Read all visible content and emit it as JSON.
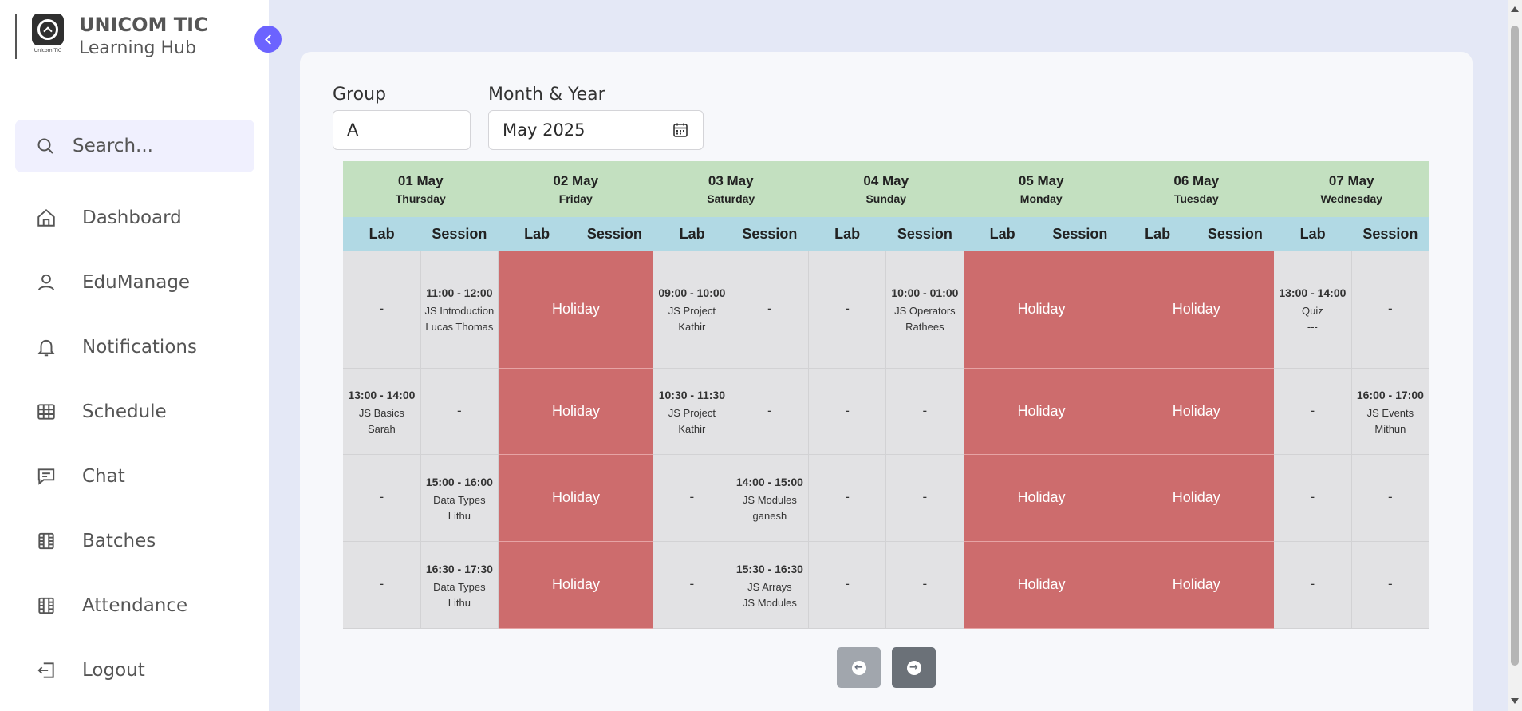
{
  "brand": {
    "title": "UNICOM TIC",
    "subtitle": "Learning Hub",
    "logo_caption": "Unicom TIC"
  },
  "search": {
    "placeholder": "Search..."
  },
  "nav": [
    {
      "label": "Dashboard",
      "icon": "home-icon"
    },
    {
      "label": "EduManage",
      "icon": "user-icon"
    },
    {
      "label": "Notifications",
      "icon": "bell-icon"
    },
    {
      "label": "Schedule",
      "icon": "table-icon"
    },
    {
      "label": "Chat",
      "icon": "chat-icon"
    },
    {
      "label": "Batches",
      "icon": "film-icon"
    },
    {
      "label": "Attendance",
      "icon": "film-icon"
    },
    {
      "label": "Logout",
      "icon": "logout-icon"
    }
  ],
  "filters": {
    "group_label": "Group",
    "group_value": "A",
    "month_label": "Month & Year",
    "month_value": "May 2025"
  },
  "schedule": {
    "sub_headers": {
      "lab": "Lab",
      "session": "Session"
    },
    "holiday_label": "Holiday",
    "empty": "-",
    "days": [
      {
        "date": "01 May",
        "weekday": "Thursday",
        "holiday": false,
        "rows": [
          {
            "lab": null,
            "session": {
              "time": "11:00 - 12:00",
              "topic": "JS Introduction",
              "teacher": "Lucas Thomas"
            }
          },
          {
            "lab": {
              "time": "13:00 - 14:00",
              "topic": "JS Basics",
              "teacher": "Sarah"
            },
            "session": null
          },
          {
            "lab": null,
            "session": {
              "time": "15:00 - 16:00",
              "topic": "Data Types",
              "teacher": "Lithu"
            }
          },
          {
            "lab": null,
            "session": {
              "time": "16:30 - 17:30",
              "topic": "Data Types",
              "teacher": "Lithu"
            }
          }
        ]
      },
      {
        "date": "02 May",
        "weekday": "Friday",
        "holiday": true,
        "rows": []
      },
      {
        "date": "03 May",
        "weekday": "Saturday",
        "holiday": false,
        "rows": [
          {
            "lab": {
              "time": "09:00 - 10:00",
              "topic": "JS Project",
              "teacher": "Kathir"
            },
            "session": null
          },
          {
            "lab": {
              "time": "10:30 - 11:30",
              "topic": "JS Project",
              "teacher": "Kathir"
            },
            "session": null
          },
          {
            "lab": null,
            "session": {
              "time": "14:00 - 15:00",
              "topic": "JS Modules",
              "teacher": "ganesh"
            }
          },
          {
            "lab": null,
            "session": {
              "time": "15:30 - 16:30",
              "topic": "JS Arrays",
              "teacher": "JS Modules"
            }
          }
        ]
      },
      {
        "date": "04 May",
        "weekday": "Sunday",
        "holiday": false,
        "rows": [
          {
            "lab": null,
            "session": {
              "time": "10:00 - 01:00",
              "topic": "JS Operators",
              "teacher": "Rathees"
            }
          },
          {
            "lab": null,
            "session": null
          },
          {
            "lab": null,
            "session": null
          },
          {
            "lab": null,
            "session": null
          }
        ]
      },
      {
        "date": "05 May",
        "weekday": "Monday",
        "holiday": true,
        "rows": []
      },
      {
        "date": "06 May",
        "weekday": "Tuesday",
        "holiday": true,
        "rows": []
      },
      {
        "date": "07 May",
        "weekday": "Wednesday",
        "holiday": false,
        "rows": [
          {
            "lab": {
              "time": "13:00 - 14:00",
              "topic": "Quiz",
              "teacher": "---"
            },
            "session": null
          },
          {
            "lab": null,
            "session": {
              "time": "16:00 - 17:00",
              "topic": "JS Events",
              "teacher": "Mithun"
            }
          },
          {
            "lab": null,
            "session": null
          },
          {
            "lab": null,
            "session": null
          }
        ]
      }
    ]
  },
  "pager": {
    "prev_icon": "arrow-left-circle-icon",
    "next_icon": "arrow-right-circle-icon"
  },
  "colors": {
    "accent": "#6c63ff",
    "holiday": "#cd6c6d",
    "day_header": "#c3e0c0",
    "sub_header": "#b1d9e4",
    "cell": "#e2e2e4"
  }
}
